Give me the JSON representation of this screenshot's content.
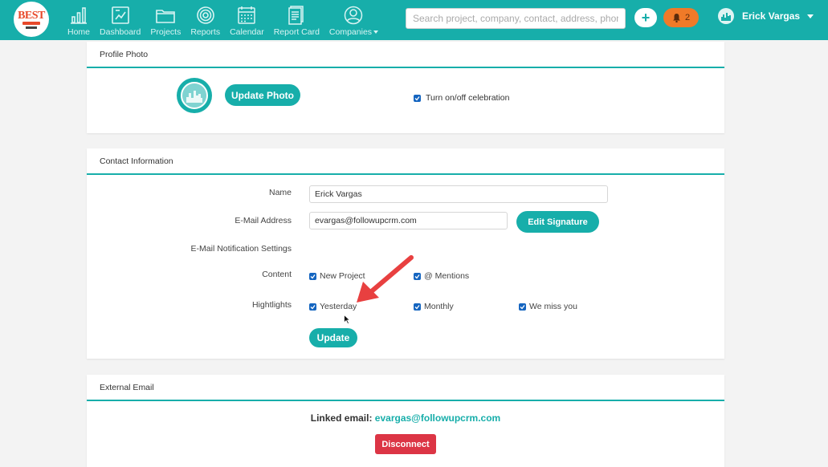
{
  "nav": {
    "items": [
      {
        "label": "Home",
        "icon": "bar-chart-icon"
      },
      {
        "label": "Dashboard",
        "icon": "dashboard-icon"
      },
      {
        "label": "Projects",
        "icon": "folder-icon"
      },
      {
        "label": "Reports",
        "icon": "target-icon"
      },
      {
        "label": "Calendar",
        "icon": "calendar-icon"
      },
      {
        "label": "Report Card",
        "icon": "report-card-icon"
      },
      {
        "label": "Companies",
        "icon": "user-circle-icon"
      }
    ],
    "search_placeholder": "Search project, company, contact, address, phone",
    "plus_label": "+",
    "notification_count": "2",
    "user_name": "Erick Vargas"
  },
  "profile_photo": {
    "title": "Profile Photo",
    "update_photo_label": "Update Photo",
    "celebration_label": "Turn on/off celebration",
    "celebration_checked": true
  },
  "contact": {
    "title": "Contact Information",
    "name_label": "Name",
    "name_value": "Erick Vargas",
    "email_label": "E-Mail Address",
    "email_value": "evargas@followupcrm.com",
    "edit_signature_label": "Edit Signature",
    "notif_label": "E-Mail Notification Settings",
    "content_label": "Content",
    "content_options": [
      {
        "label": "New Project",
        "checked": true
      },
      {
        "label": "@ Mentions",
        "checked": true
      }
    ],
    "highlights_label": "Hightlights",
    "highlight_options": [
      {
        "label": "Yesterday",
        "checked": true
      },
      {
        "label": "Monthly",
        "checked": true
      },
      {
        "label": "We miss you",
        "checked": true
      }
    ],
    "update_label": "Update"
  },
  "external_email": {
    "title": "External Email",
    "linked_label": "Linked email:",
    "linked_value": "evargas@followupcrm.com",
    "disconnect_label": "Disconnect"
  },
  "colors": {
    "accent": "#17aeaa",
    "danger": "#dc3545",
    "notification": "#f07a28",
    "checkbox": "#1565c0"
  }
}
